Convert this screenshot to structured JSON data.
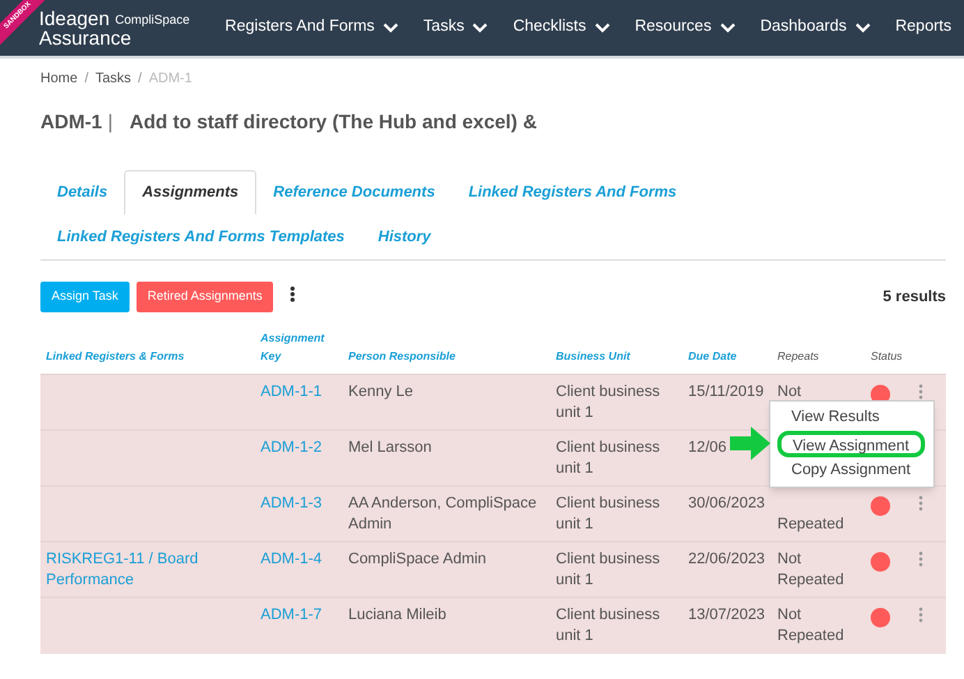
{
  "ribbon": "SANDBOX",
  "logo": {
    "brand": "Ideagen",
    "sub": "CompliSpace",
    "product": "Assurance"
  },
  "nav": [
    {
      "label": "Registers And Forms",
      "dropdown": true
    },
    {
      "label": "Tasks",
      "dropdown": true
    },
    {
      "label": "Checklists",
      "dropdown": true
    },
    {
      "label": "Resources",
      "dropdown": true
    },
    {
      "label": "Dashboards",
      "dropdown": true
    },
    {
      "label": "Reports",
      "dropdown": false
    }
  ],
  "breadcrumb": {
    "separator": "/",
    "items": [
      {
        "label": "Home",
        "current": false
      },
      {
        "label": "Tasks",
        "current": false
      },
      {
        "label": "ADM-1",
        "current": true
      }
    ]
  },
  "title": {
    "key": "ADM-1",
    "divider": "|",
    "name": "Add to staff directory (The Hub and excel) &"
  },
  "tabs": [
    {
      "label": "Details",
      "selected": false
    },
    {
      "label": "Assignments",
      "selected": true
    },
    {
      "label": "Reference Documents",
      "selected": false
    },
    {
      "label": "Linked Registers And Forms",
      "selected": false
    },
    {
      "label": "Linked Registers And Forms Templates",
      "selected": false
    },
    {
      "label": "History",
      "selected": false
    }
  ],
  "buttons": [
    {
      "label": "Assign Task",
      "kind": "primary"
    },
    {
      "label": "Retired Assignments",
      "kind": "danger"
    }
  ],
  "results": "5 results",
  "table": {
    "columns": [
      {
        "label": "Linked Registers & Forms",
        "sortable": true
      },
      {
        "label": "Assignment Key",
        "sortable": true
      },
      {
        "label": "Person Responsible",
        "sortable": true
      },
      {
        "label": "Business Unit",
        "sortable": true
      },
      {
        "label": "Due Date",
        "sortable": true
      },
      {
        "label": "Repeats",
        "sortable": false
      },
      {
        "label": "Status",
        "sortable": false
      }
    ],
    "rows": [
      {
        "linked": "",
        "key": "ADM-1-1",
        "person": "Kenny Le",
        "unit": "Client business unit 1",
        "due": "15/11/2019",
        "repeats": "Not",
        "color": "#ff5a5a"
      },
      {
        "linked": "",
        "key": "ADM-1-2",
        "person": "Mel Larsson",
        "unit": "Client business unit 1",
        "due": "12/06"
      },
      {
        "linked": "",
        "key": "ADM-1-3",
        "person": "AA Anderson, CompliSpace Admin",
        "unit": "Client business unit 1",
        "due": "30/06/2023",
        "repeats": "Repeated",
        "repeats_first_line_covered": true,
        "color": "#ff5a5a"
      },
      {
        "linked": "RISKREG1-11 / Board Performance",
        "key": "ADM-1-4",
        "person": "CompliSpace Admin",
        "unit": "Client business unit 1",
        "due": "22/06/2023",
        "repeats": "Not Repeated",
        "color": "#ff5a5a"
      },
      {
        "linked": "",
        "key": "ADM-1-7",
        "person": "Luciana Mileib",
        "unit": "Client business unit 1",
        "due": "13/07/2023",
        "repeats": "Not Repeated",
        "color": "#ff5a5a"
      }
    ]
  },
  "menu": [
    {
      "label": "View Results",
      "highlighted": false
    },
    {
      "label": "View Assignment",
      "highlighted": true
    },
    {
      "label": "Copy Assignment",
      "highlighted": false
    }
  ]
}
